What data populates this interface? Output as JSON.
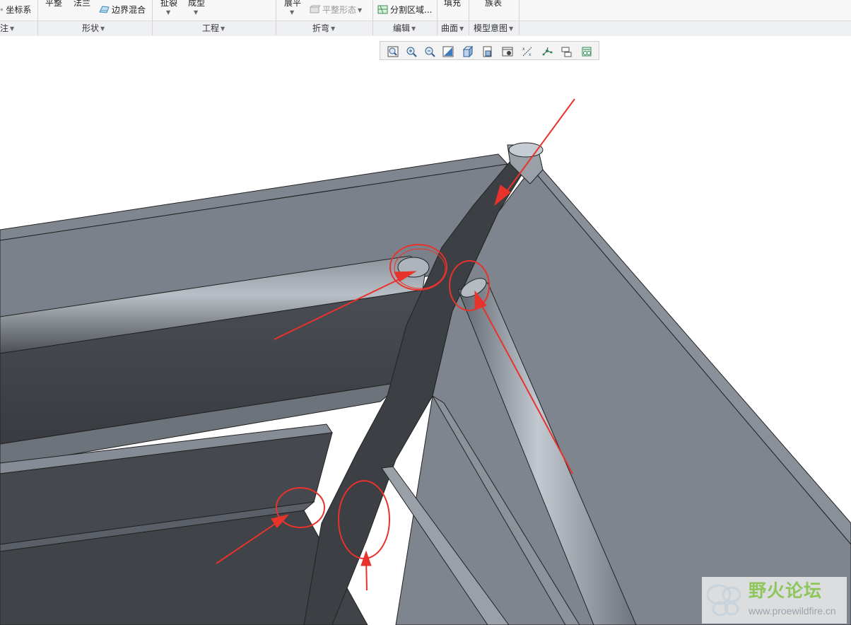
{
  "ribbon": {
    "row1": {
      "coord_sys": "坐标系",
      "flat": "平整",
      "flange": "法兰",
      "boundary_blend": "边界混合",
      "rip": "扯裂",
      "form": "成型",
      "unbend": "展平",
      "flat_state": "平整形态",
      "split_area": "分割区域...",
      "fill": "填充",
      "family_table": "族表"
    },
    "groups": {
      "partial": "注",
      "shape": "形状",
      "engineering": "工程",
      "bend": "折弯",
      "edit": "编辑",
      "surface": "曲面",
      "model_intent": "模型意图"
    }
  },
  "view_toolbar": {
    "icons": [
      "refit-icon",
      "zoom-in-icon",
      "zoom-out-icon",
      "repaint-icon",
      "display-style-icon",
      "saved-views-icon",
      "view-manager-icon",
      "datum-display-icon",
      "spin-center-icon",
      "annotation-display-icon",
      "appearance-icon"
    ]
  },
  "colors": {
    "model_face_light": "#7d838c",
    "model_face_dark": "#3a3d42",
    "annotation_red": "#e8322c"
  },
  "watermark": {
    "title": "野火论坛",
    "url": "www.proewildfire.cn"
  }
}
